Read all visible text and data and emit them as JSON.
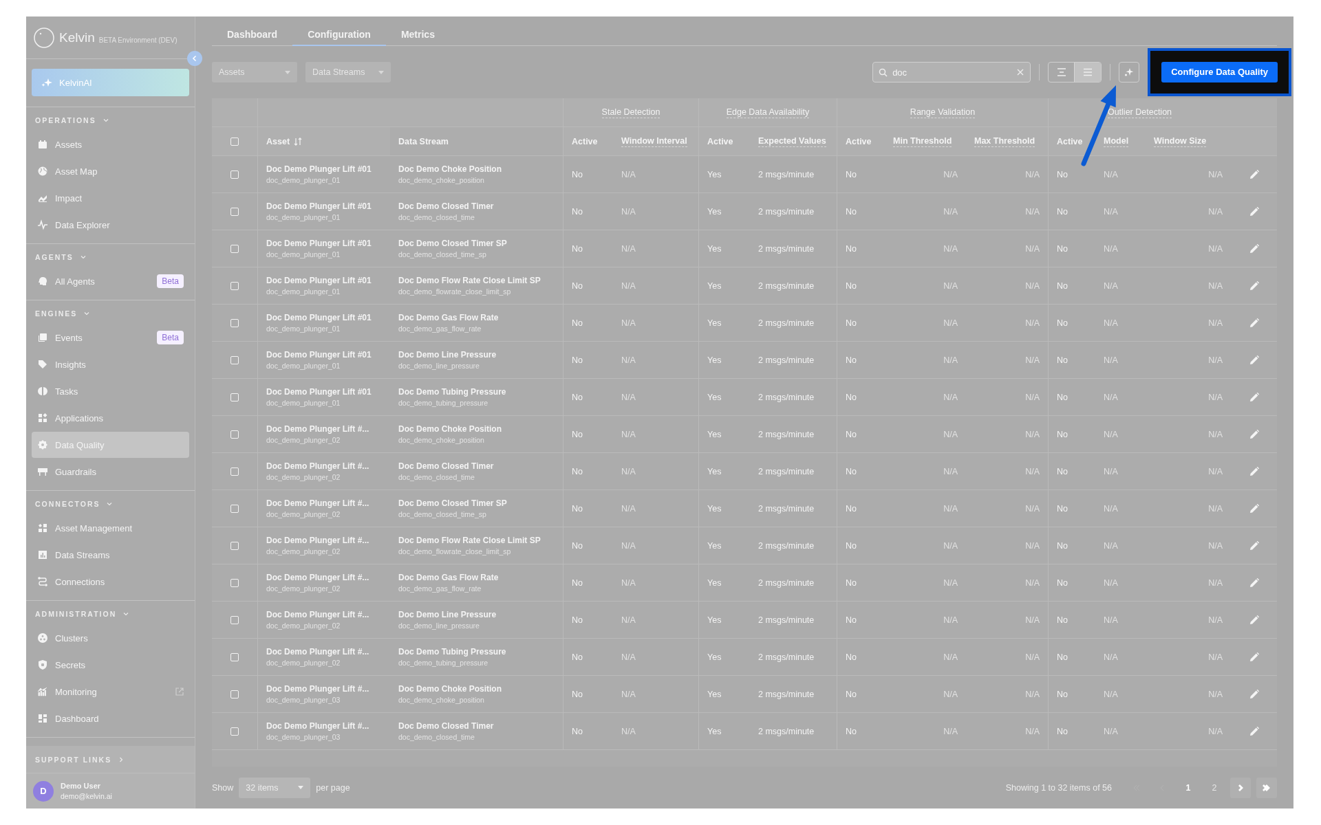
{
  "sidebar": {
    "logo": {
      "name": "Kelvin",
      "environment": "BETA Environment (DEV)"
    },
    "kelvin_ai": {
      "label": "KelvinAI"
    },
    "sections": [
      {
        "title": "OPERATIONS",
        "expanded": true,
        "items": [
          {
            "label": "Assets",
            "selected": false,
            "external": false
          },
          {
            "label": "Asset Map",
            "selected": false,
            "external": false
          },
          {
            "label": "Impact",
            "selected": false,
            "external": false
          },
          {
            "label": "Data Explorer",
            "selected": false,
            "external": false
          }
        ]
      },
      {
        "title": "AGENTS",
        "expanded": true,
        "items": [
          {
            "label": "All Agents",
            "badge": "Beta",
            "selected": false,
            "external": false
          }
        ]
      },
      {
        "title": "ENGINES",
        "expanded": true,
        "items": [
          {
            "label": "Events",
            "badge": "Beta",
            "selected": false,
            "external": false
          },
          {
            "label": "Insights",
            "selected": false,
            "external": false
          },
          {
            "label": "Tasks",
            "selected": false,
            "external": false
          },
          {
            "label": "Applications",
            "selected": false,
            "external": false
          },
          {
            "label": "Data Quality",
            "selected": true,
            "external": false
          },
          {
            "label": "Guardrails",
            "selected": false,
            "external": false
          }
        ]
      },
      {
        "title": "CONNECTORS",
        "expanded": true,
        "items": [
          {
            "label": "Asset Management",
            "selected": false,
            "external": false
          },
          {
            "label": "Data Streams",
            "selected": false,
            "external": false
          },
          {
            "label": "Connections",
            "selected": false,
            "external": false
          }
        ]
      },
      {
        "title": "ADMINISTRATION",
        "expanded": true,
        "items": [
          {
            "label": "Clusters",
            "selected": false,
            "external": false
          },
          {
            "label": "Secrets",
            "selected": false,
            "external": false
          },
          {
            "label": "Monitoring",
            "selected": false,
            "external": true
          },
          {
            "label": "Dashboard",
            "selected": false,
            "external": false
          }
        ]
      }
    ],
    "support_links": {
      "label": "SUPPORT LINKS",
      "expanded": false
    },
    "user": {
      "initial": "D",
      "name": "Demo User",
      "email": "demo@kelvin.ai"
    }
  },
  "tabs": [
    {
      "label": "Dashboard",
      "selected": false
    },
    {
      "label": "Configuration",
      "selected": true
    },
    {
      "label": "Metrics",
      "selected": false
    }
  ],
  "filters": [
    {
      "placeholder": "Assets"
    },
    {
      "placeholder": "Data Streams"
    }
  ],
  "search": {
    "value": "doc"
  },
  "view_toggle": [
    {
      "selected": false
    },
    {
      "selected": true
    }
  ],
  "configure_button": {
    "label": "Configure Data Quality",
    "highlighted": true
  },
  "table": {
    "header_checked": false,
    "columns": [
      "Asset",
      "Data Stream"
    ],
    "column_groups": [
      {
        "label": "Stale Detection",
        "columns": [
          "Active",
          "Window Interval"
        ]
      },
      {
        "label": "Edge Data Availability",
        "columns": [
          "Active",
          "Expected Values"
        ]
      },
      {
        "label": "Range Validation",
        "columns": [
          "Active",
          "Min Threshold",
          "Max Threshold"
        ]
      },
      {
        "label": "Outlier Detection",
        "columns": [
          "Active",
          "Model",
          "Window Size"
        ]
      }
    ],
    "rows": [
      {
        "checked": false,
        "asset": "Doc Demo Plunger Lift #01",
        "asset_id": "doc_demo_plunger_01",
        "stream": "Doc Demo Choke Position",
        "stream_id": "doc_demo_choke_position",
        "cells": [
          "No",
          "N/A",
          "Yes",
          "2 msgs/minute",
          "No",
          "N/A",
          "N/A",
          "No",
          "N/A",
          "N/A"
        ]
      },
      {
        "checked": false,
        "asset": "Doc Demo Plunger Lift #01",
        "asset_id": "doc_demo_plunger_01",
        "stream": "Doc Demo Closed Timer",
        "stream_id": "doc_demo_closed_time",
        "cells": [
          "No",
          "N/A",
          "Yes",
          "2 msgs/minute",
          "No",
          "N/A",
          "N/A",
          "No",
          "N/A",
          "N/A"
        ]
      },
      {
        "checked": false,
        "asset": "Doc Demo Plunger Lift #01",
        "asset_id": "doc_demo_plunger_01",
        "stream": "Doc Demo Closed Timer SP",
        "stream_id": "doc_demo_closed_time_sp",
        "cells": [
          "No",
          "N/A",
          "Yes",
          "2 msgs/minute",
          "No",
          "N/A",
          "N/A",
          "No",
          "N/A",
          "N/A"
        ]
      },
      {
        "checked": false,
        "asset": "Doc Demo Plunger Lift #01",
        "asset_id": "doc_demo_plunger_01",
        "stream": "Doc Demo Flow Rate Close Limit SP",
        "stream_id": "doc_demo_flowrate_close_limit_sp",
        "cells": [
          "No",
          "N/A",
          "Yes",
          "2 msgs/minute",
          "No",
          "N/A",
          "N/A",
          "No",
          "N/A",
          "N/A"
        ]
      },
      {
        "checked": false,
        "asset": "Doc Demo Plunger Lift #01",
        "asset_id": "doc_demo_plunger_01",
        "stream": "Doc Demo Gas Flow Rate",
        "stream_id": "doc_demo_gas_flow_rate",
        "cells": [
          "No",
          "N/A",
          "Yes",
          "2 msgs/minute",
          "No",
          "N/A",
          "N/A",
          "No",
          "N/A",
          "N/A"
        ]
      },
      {
        "checked": false,
        "asset": "Doc Demo Plunger Lift #01",
        "asset_id": "doc_demo_plunger_01",
        "stream": "Doc Demo Line Pressure",
        "stream_id": "doc_demo_line_pressure",
        "cells": [
          "No",
          "N/A",
          "Yes",
          "2 msgs/minute",
          "No",
          "N/A",
          "N/A",
          "No",
          "N/A",
          "N/A"
        ]
      },
      {
        "checked": false,
        "asset": "Doc Demo Plunger Lift #01",
        "asset_id": "doc_demo_plunger_01",
        "stream": "Doc Demo Tubing Pressure",
        "stream_id": "doc_demo_tubing_pressure",
        "cells": [
          "No",
          "N/A",
          "Yes",
          "2 msgs/minute",
          "No",
          "N/A",
          "N/A",
          "No",
          "N/A",
          "N/A"
        ]
      },
      {
        "checked": false,
        "asset": "Doc Demo Plunger Lift #...",
        "asset_id": "doc_demo_plunger_02",
        "stream": "Doc Demo Choke Position",
        "stream_id": "doc_demo_choke_position",
        "cells": [
          "No",
          "N/A",
          "Yes",
          "2 msgs/minute",
          "No",
          "N/A",
          "N/A",
          "No",
          "N/A",
          "N/A"
        ]
      },
      {
        "checked": false,
        "asset": "Doc Demo Plunger Lift #...",
        "asset_id": "doc_demo_plunger_02",
        "stream": "Doc Demo Closed Timer",
        "stream_id": "doc_demo_closed_time",
        "cells": [
          "No",
          "N/A",
          "Yes",
          "2 msgs/minute",
          "No",
          "N/A",
          "N/A",
          "No",
          "N/A",
          "N/A"
        ]
      },
      {
        "checked": false,
        "asset": "Doc Demo Plunger Lift #...",
        "asset_id": "doc_demo_plunger_02",
        "stream": "Doc Demo Closed Timer SP",
        "stream_id": "doc_demo_closed_time_sp",
        "cells": [
          "No",
          "N/A",
          "Yes",
          "2 msgs/minute",
          "No",
          "N/A",
          "N/A",
          "No",
          "N/A",
          "N/A"
        ]
      },
      {
        "checked": false,
        "asset": "Doc Demo Plunger Lift #...",
        "asset_id": "doc_demo_plunger_02",
        "stream": "Doc Demo Flow Rate Close Limit SP",
        "stream_id": "doc_demo_flowrate_close_limit_sp",
        "cells": [
          "No",
          "N/A",
          "Yes",
          "2 msgs/minute",
          "No",
          "N/A",
          "N/A",
          "No",
          "N/A",
          "N/A"
        ]
      },
      {
        "checked": false,
        "asset": "Doc Demo Plunger Lift #...",
        "asset_id": "doc_demo_plunger_02",
        "stream": "Doc Demo Gas Flow Rate",
        "stream_id": "doc_demo_gas_flow_rate",
        "cells": [
          "No",
          "N/A",
          "Yes",
          "2 msgs/minute",
          "No",
          "N/A",
          "N/A",
          "No",
          "N/A",
          "N/A"
        ]
      },
      {
        "checked": false,
        "asset": "Doc Demo Plunger Lift #...",
        "asset_id": "doc_demo_plunger_02",
        "stream": "Doc Demo Line Pressure",
        "stream_id": "doc_demo_line_pressure",
        "cells": [
          "No",
          "N/A",
          "Yes",
          "2 msgs/minute",
          "No",
          "N/A",
          "N/A",
          "No",
          "N/A",
          "N/A"
        ]
      },
      {
        "checked": false,
        "asset": "Doc Demo Plunger Lift #...",
        "asset_id": "doc_demo_plunger_02",
        "stream": "Doc Demo Tubing Pressure",
        "stream_id": "doc_demo_tubing_pressure",
        "cells": [
          "No",
          "N/A",
          "Yes",
          "2 msgs/minute",
          "No",
          "N/A",
          "N/A",
          "No",
          "N/A",
          "N/A"
        ]
      },
      {
        "checked": false,
        "asset": "Doc Demo Plunger Lift #...",
        "asset_id": "doc_demo_plunger_03",
        "stream": "Doc Demo Choke Position",
        "stream_id": "doc_demo_choke_position",
        "cells": [
          "No",
          "N/A",
          "Yes",
          "2 msgs/minute",
          "No",
          "N/A",
          "N/A",
          "No",
          "N/A",
          "N/A"
        ]
      },
      {
        "checked": false,
        "asset": "Doc Demo Plunger Lift #...",
        "asset_id": "doc_demo_plunger_03",
        "stream": "Doc Demo Closed Timer",
        "stream_id": "doc_demo_closed_time",
        "cells": [
          "No",
          "N/A",
          "Yes",
          "2 msgs/minute",
          "No",
          "N/A",
          "N/A",
          "No",
          "N/A",
          "N/A"
        ]
      }
    ]
  },
  "footer": {
    "show_label": "Show",
    "page_size": "32 items",
    "per_page_label": "per page",
    "summary": "Showing 1 to 32 items of 56",
    "pages": [
      {
        "label": "1",
        "selected": true
      },
      {
        "label": "2",
        "selected": false
      }
    ],
    "page_nav": [
      {
        "kind": "first",
        "disabled": true
      },
      {
        "kind": "previous",
        "disabled": true
      },
      {
        "kind": "next",
        "disabled": false
      },
      {
        "kind": "last",
        "disabled": false
      }
    ]
  }
}
